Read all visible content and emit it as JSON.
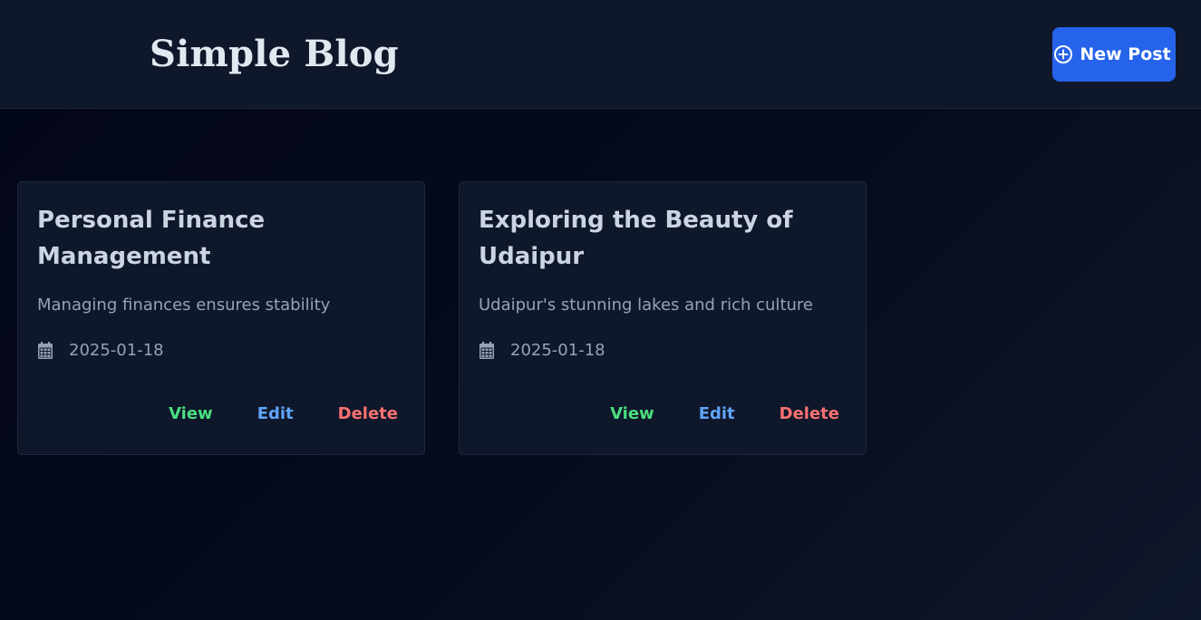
{
  "header": {
    "title": "Simple Blog",
    "new_post_label": "New Post",
    "new_post_icon": "plus-circle-icon",
    "accent_color": "#2563eb"
  },
  "posts": [
    {
      "title": "Personal Finance Management",
      "excerpt": "Managing finances ensures stability",
      "date": "2025-01-18",
      "date_icon": "calendar-icon",
      "actions": {
        "view": "View",
        "edit": "Edit",
        "delete": "Delete"
      }
    },
    {
      "title": "Exploring the Beauty of Udaipur",
      "excerpt": "Udaipur's stunning lakes and rich culture",
      "date": "2025-01-18",
      "date_icon": "calendar-icon",
      "actions": {
        "view": "View",
        "edit": "Edit",
        "delete": "Delete"
      }
    }
  ],
  "colors": {
    "view": "#4ade80",
    "edit": "#60a5fa",
    "delete": "#f87171"
  }
}
